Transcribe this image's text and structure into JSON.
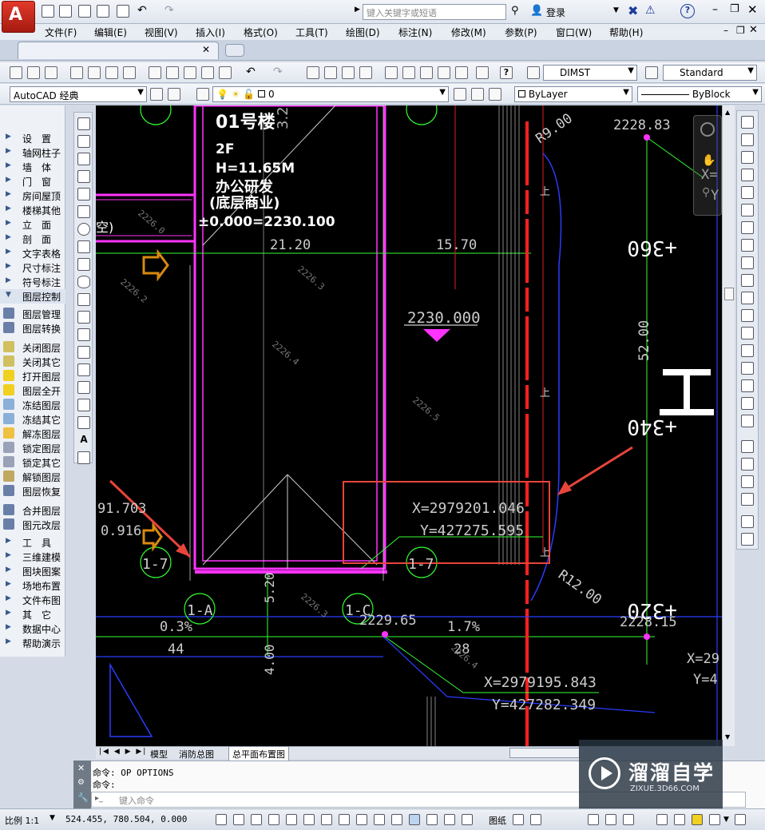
{
  "title_bar": {
    "search_placeholder": "键入关键字或短语",
    "login_label": "登录",
    "window_controls": [
      "minimize-icon",
      "restore-icon",
      "close-icon"
    ]
  },
  "menu": {
    "items": [
      "文件(F)",
      "编辑(E)",
      "视图(V)",
      "插入(I)",
      "格式(O)",
      "工具(T)",
      "绘图(D)",
      "标注(N)",
      "修改(M)",
      "参数(P)",
      "窗口(W)",
      "帮助(H)"
    ]
  },
  "toolbar": {
    "dimstyle": "DIMST",
    "textstyle": "Standard",
    "workspace": "AutoCAD 经典",
    "layer": "0",
    "color": "ByLayer",
    "linetype": "ByBlock"
  },
  "left_panel": {
    "items": [
      "设　置",
      "轴网柱子",
      "墙　体",
      "门　窗",
      "房间屋顶",
      "楼梯其他",
      "立　面",
      "剖　面",
      "文字表格",
      "尺寸标注",
      "符号标注",
      "图层控制",
      "图层管理",
      "图层转换",
      "关闭图层",
      "关闭其它",
      "打开图层",
      "图层全开",
      "冻结图层",
      "冻结其它",
      "解冻图层",
      "锁定图层",
      "锁定其它",
      "解锁图层",
      "图层恢复",
      "合并图层",
      "图元改层",
      "工　具",
      "三维建模",
      "图块图案",
      "场地布置",
      "文件布图",
      "其　它",
      "数据中心",
      "帮助演示"
    ]
  },
  "drawing": {
    "building_name": "01号楼",
    "side_number": "3.2",
    "floors": "2F",
    "height": "H=11.65M",
    "use1": "办公研发",
    "use2": "(底层商业)",
    "datum": "±0.000=2230.100",
    "dim_width1": "21.20",
    "dim_width2": "15.70",
    "elev_main": "2230.000",
    "radius1": "R9.00",
    "radius2": "R12.00",
    "top_coord": "2228.83",
    "coord1_x": "X=2979201.046",
    "coord1_y": "Y=427275.595",
    "coord2_x": "X=2979195.843",
    "coord2_y": "Y=427282.349",
    "station1": "+360",
    "station2": "+340",
    "station3": "+320",
    "station_len": "52.00",
    "axis_1_7a": "1-7",
    "axis_1_7b": "1-7",
    "axis_1_a": "1-A",
    "axis_1_c": "1-C",
    "slope1": "0.3%",
    "slope1_len": "44",
    "slope2": "1.7%",
    "slope2_len": "28",
    "elev_2229": "2229.65",
    "elev_2228_15": "2228.15",
    "dim_520": "5.20",
    "dim_400": "4.00",
    "left_val1": "91.703",
    "left_val2": "0.916",
    "left_label": "空)",
    "gray_levels": [
      "2226.0",
      "2226.2",
      "2226.3",
      "2226.4",
      "2226.5",
      "2226.3",
      "2226.4"
    ],
    "up_label": "上",
    "right_partial_x": "X=",
    "right_partial_y": "Y",
    "right_partial_x2": "X=29",
    "right_partial_y2": "Y=4",
    "big_char": "工"
  },
  "layout_tabs": [
    "模型",
    "消防总图",
    "总平面布置图"
  ],
  "command": {
    "line1": "命令: OP OPTIONS",
    "line2": "命令:",
    "input_placeholder": "键入命令"
  },
  "status": {
    "scale": "比例 1:1",
    "coords": "524.455, 780.504, 0.000",
    "paper": "图纸"
  },
  "watermark": {
    "brand": "溜溜自学",
    "url": "ZIXUE.3D66.COM"
  },
  "colors": {
    "canvas": "#000000",
    "magenta": "#ff33ff",
    "red_line": "#ff2020",
    "green": "#33ff33",
    "blue": "#2a3cff",
    "highlight_box": "#e8453a"
  }
}
